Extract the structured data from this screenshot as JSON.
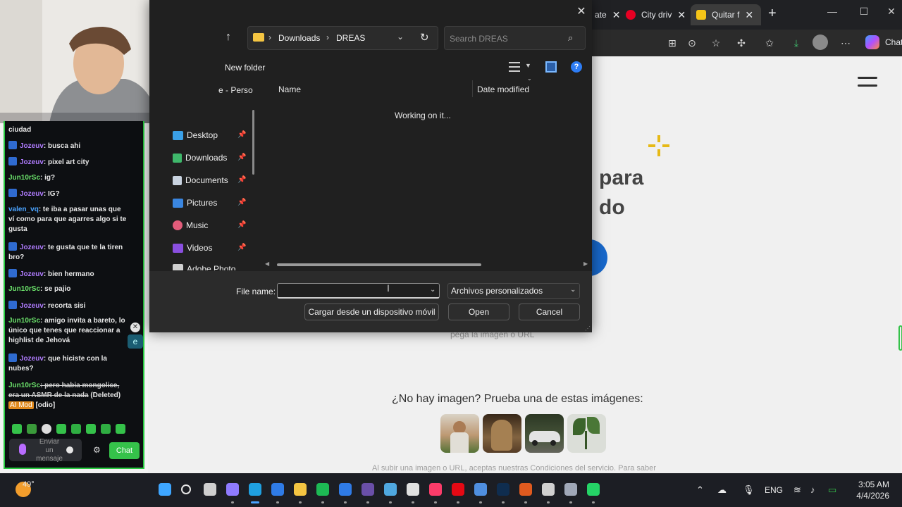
{
  "browser": {
    "tabs": [
      {
        "label": "ate",
        "fav_color": "#888888"
      },
      {
        "label": "City driv",
        "fav_color": "#e60023"
      },
      {
        "label": "Quitar f",
        "fav_color": "#f5c518",
        "active": true
      }
    ],
    "new_tab": "+",
    "copilot_label": "Chat"
  },
  "page": {
    "hero_line1": "para",
    "hero_line2": "do",
    "paste_text": "pega la imagen o URL",
    "no_image_text": "¿No hay imagen? Prueba una de estas imágenes:",
    "legal_text": "Al subir una imagen o URL, aceptas nuestras Condiciones del servicio. Para saber",
    "thumbs": [
      {
        "name": "woman",
        "color": "#c9a27a"
      },
      {
        "name": "cat",
        "color": "#8a6a45"
      },
      {
        "name": "car",
        "color": "#4b5a3e"
      },
      {
        "name": "plant",
        "color": "#e9ece6"
      }
    ]
  },
  "chat": {
    "messages": [
      {
        "user": "",
        "text": "ciudad",
        "cls": ""
      },
      {
        "user": "Jozeuv",
        "text": ": busca ahi",
        "cls": "user-jz",
        "icon": true
      },
      {
        "user": "Jozeuv",
        "text": ": pixel art city",
        "cls": "user-jz",
        "icon": true
      },
      {
        "user": "Jun10rSc",
        "text": ": ig?",
        "cls": "user-jn"
      },
      {
        "user": "Jozeuv",
        "text": ": IG?",
        "cls": "user-jz",
        "icon": true
      },
      {
        "user": "valen_vq",
        "text": ": te iba a pasar unas que ví como para que agarres algo si te gusta",
        "cls": "user-vl"
      },
      {
        "user": "Jozeuv",
        "text": ": te gusta que te la tiren bro?",
        "cls": "user-jz",
        "icon": true
      },
      {
        "user": "Jozeuv",
        "text": ": bien hermano",
        "cls": "user-jz",
        "icon": true
      },
      {
        "user": "Jun10rSc",
        "text": ": se pajio",
        "cls": "user-jn"
      },
      {
        "user": "Jozeuv",
        "text": ": recorta sisi",
        "cls": "user-jz",
        "icon": true
      },
      {
        "user": "Jun10rSc",
        "text": ": amigo invita a bareto, lo único que tenes que reaccionar a highlist de Jehová",
        "cls": "user-jn"
      },
      {
        "user": "Jozeuv",
        "text": ": que hiciste con la nubes?",
        "cls": "user-jz",
        "icon": true
      },
      {
        "user": "Jun10rSc",
        "text": ": pero habia mongolice, era un ASMR de la nada",
        "cls": "user-jn",
        "deleted": true
      }
    ],
    "deleted_label": "(Deleted)",
    "aimod_label": "AI Mod",
    "odio_label": "[odio]",
    "input_placeholder": "Enviar un mensaje",
    "send_label": "Chat",
    "side_x": "✕",
    "side_e": "e"
  },
  "dialog": {
    "breadcrumb": [
      "Downloads",
      "DREAS"
    ],
    "search_placeholder": "Search DREAS",
    "new_folder": "New folder",
    "sidebar_cut": "e - Perso",
    "sidebar": [
      {
        "label": "Desktop",
        "color": "#3aa0e8"
      },
      {
        "label": "Downloads",
        "color": "#3fb86b"
      },
      {
        "label": "Documents",
        "color": "#c9d3e0"
      },
      {
        "label": "Pictures",
        "color": "#3a86e0"
      },
      {
        "label": "Music",
        "color": "#e25c7a"
      },
      {
        "label": "Videos",
        "color": "#8a4fe0"
      },
      {
        "label": "Adobe Photo",
        "color": "#cfcfcf"
      }
    ],
    "col_name": "Name",
    "col_date": "Date modified",
    "working": "Working on it...",
    "filename_label": "File name:",
    "filename_value": "",
    "filetype": "Archivos personalizados",
    "btn_mobile": "Cargar desde un dispositivo móvil",
    "btn_open": "Open",
    "btn_cancel": "Cancel"
  },
  "taskbar": {
    "temp": "49°",
    "lang": "ENG",
    "time": "3:05 AM",
    "date": "4/4/2026",
    "apps": [
      {
        "name": "start",
        "color": "#3ea6ff"
      },
      {
        "name": "search",
        "color": "#e6e6e6"
      },
      {
        "name": "taskview",
        "color": "#cfcfcf"
      },
      {
        "name": "copilot",
        "color": "#8f7bff"
      },
      {
        "name": "edge",
        "color": "#1fa0e0"
      },
      {
        "name": "store",
        "color": "#2f7be6"
      },
      {
        "name": "explorer",
        "color": "#f4c542"
      },
      {
        "name": "spotify",
        "color": "#1db954"
      },
      {
        "name": "defender",
        "color": "#2f7be6"
      },
      {
        "name": "obs",
        "color": "#6a4fa8"
      },
      {
        "name": "snipping",
        "color": "#4fa8e0"
      },
      {
        "name": "paint",
        "color": "#e0e0e0"
      },
      {
        "name": "music",
        "color": "#fc3c6a"
      },
      {
        "name": "netflix",
        "color": "#e50914"
      },
      {
        "name": "calculator",
        "color": "#4f8fe0"
      },
      {
        "name": "photoshop",
        "color": "#0f2d4f"
      },
      {
        "name": "illustrator",
        "color": "#e05a1f"
      },
      {
        "name": "chatgpt",
        "color": "#d0d0d0"
      },
      {
        "name": "settings",
        "color": "#a0a8b8"
      },
      {
        "name": "whatsapp",
        "color": "#25d366"
      }
    ]
  }
}
